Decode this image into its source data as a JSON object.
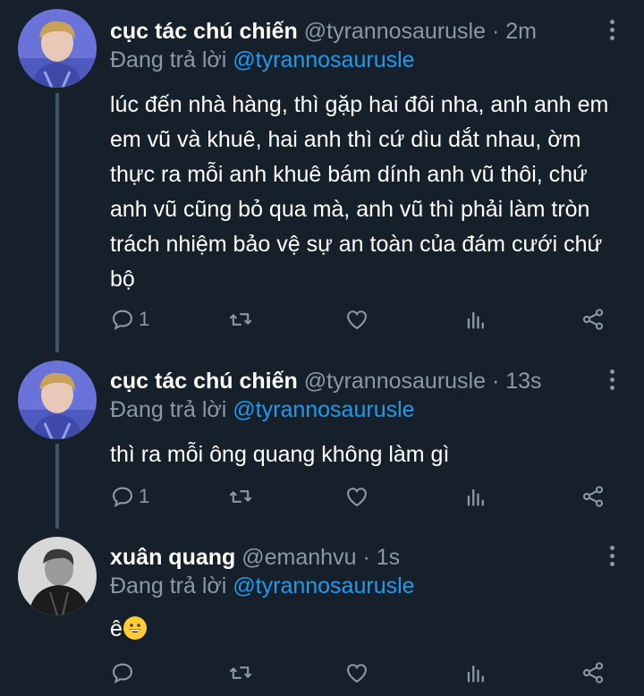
{
  "colors": {
    "background": "#15202b",
    "text": "#ffffff",
    "secondary": "#8b98a5",
    "link": "#1d9bf0",
    "thread_line": "#3d5466"
  },
  "tweets": [
    {
      "name": "cục tác chú chiến",
      "handle": "@tyrannosaurusle",
      "dot": "·",
      "time": "2m",
      "reply_prefix": "Đang trả lời",
      "reply_to": "@tyrannosaurusle",
      "text": "lúc đến nhà hàng, thì gặp hai đôi nha, anh anh em em vũ và khuê, hai anh thì cứ dìu dắt nhau, ờm thực ra mỗi anh khuê bám dính anh vũ thôi, chứ anh vũ cũng bỏ qua mà, anh vũ thì phải làm tròn trách nhiệm bảo vệ sự an toàn của đám cưới chứ bộ",
      "reply_count": "1",
      "avatar": "person-avatar-blue"
    },
    {
      "name": "cục tác chú chiến",
      "handle": "@tyrannosaurusle",
      "dot": "·",
      "time": "13s",
      "reply_prefix": "Đang trả lời",
      "reply_to": "@tyrannosaurusle",
      "text": "thì ra mỗi ông quang không làm gì",
      "reply_count": "1",
      "avatar": "person-avatar-blue"
    },
    {
      "name": "xuân quang",
      "handle": "@emanhvu",
      "dot": "·",
      "time": "1s",
      "reply_prefix": "Đang trả lời",
      "reply_to": "@tyrannosaurusle",
      "text": "ê",
      "emoji": "grinning-face-emoji",
      "reply_count": "",
      "avatar": "person-avatar-monochrome"
    }
  ],
  "icons": [
    "reply-icon",
    "retweet-icon",
    "like-icon",
    "analytics-icon",
    "share-icon",
    "more-icon"
  ]
}
